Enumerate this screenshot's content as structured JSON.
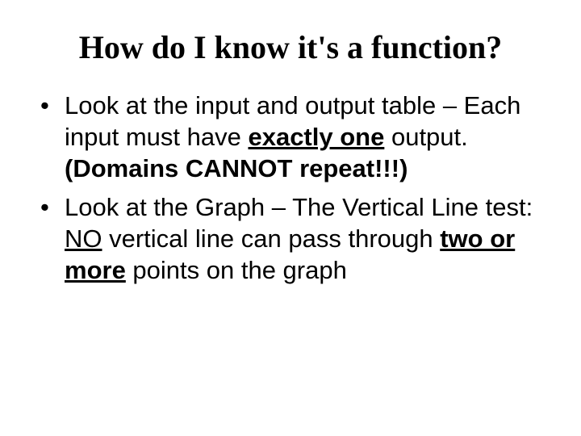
{
  "title": "How do I know it's a function?",
  "bullets": [
    {
      "part1": "Look at the input and output table – Each input must have ",
      "exactly_one": "exactly one",
      "part2": " output. ",
      "domains_cannot": "(Domains CANNOT repeat!!!)"
    },
    {
      "part1": "Look at the Graph – The Vertical Line test: ",
      "no": "NO",
      "part2": " vertical line can pass through ",
      "two_or_more": "two or more",
      "part3": " points on the graph"
    }
  ]
}
